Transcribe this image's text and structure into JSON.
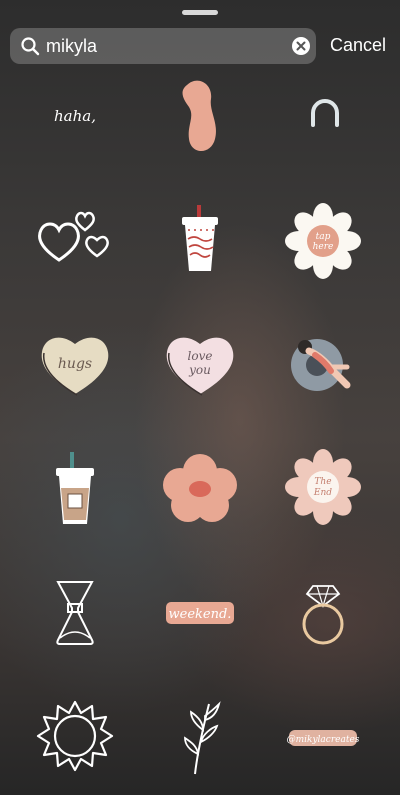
{
  "search": {
    "query": "mikyla",
    "placeholder": "Search",
    "cancel_label": "Cancel"
  },
  "stickers": [
    {
      "name": "haha-sticker",
      "text": "haha,"
    },
    {
      "name": "pink-bean-sticker"
    },
    {
      "name": "arch-sticker"
    },
    {
      "name": "hearts-sticker"
    },
    {
      "name": "soda-cup-sticker"
    },
    {
      "name": "tap-here-daisy-sticker",
      "text_line1": "tap",
      "text_line2": "here"
    },
    {
      "name": "hugs-heart-sticker",
      "text": "hugs"
    },
    {
      "name": "love-you-heart-sticker",
      "text_line1": "love",
      "text_line2": "you"
    },
    {
      "name": "pool-float-sticker"
    },
    {
      "name": "iced-coffee-sticker"
    },
    {
      "name": "pink-flower-sticker"
    },
    {
      "name": "the-end-daisy-sticker",
      "text_line1": "The",
      "text_line2": "End"
    },
    {
      "name": "chemex-sticker"
    },
    {
      "name": "weekend-sticker",
      "text": "weekend."
    },
    {
      "name": "ring-sticker"
    },
    {
      "name": "sun-sticker"
    },
    {
      "name": "leaf-branch-sticker"
    },
    {
      "name": "mikylacreates-sticker",
      "text": "@mikylacreates"
    }
  ],
  "colors": {
    "peach": "#e8a893",
    "cream": "#e9dcc1",
    "blush": "#f1d9de",
    "white": "#ffffff",
    "slate": "#8f9aa4"
  }
}
